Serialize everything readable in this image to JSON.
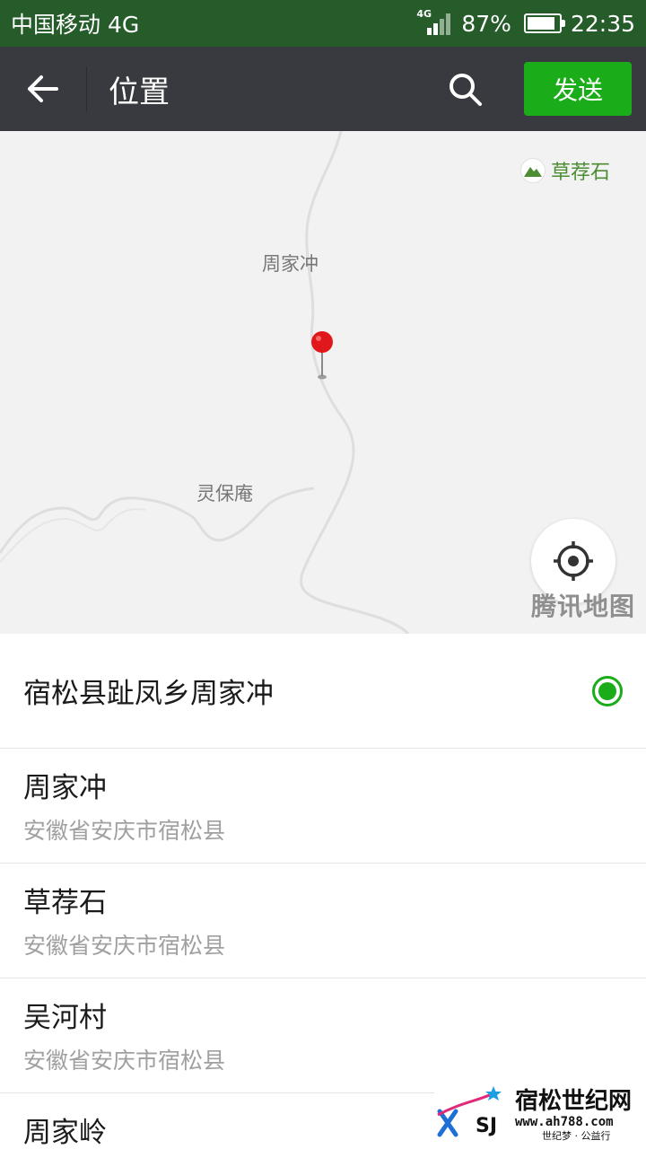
{
  "status_bar": {
    "carrier": "中国移动 4G",
    "network_tag": "4G",
    "battery": "87%",
    "battery_level": 0.87,
    "time": "22:35"
  },
  "header": {
    "title": "位置",
    "send_label": "发送",
    "back_icon": "arrow-left-icon",
    "search_icon": "search-icon"
  },
  "map": {
    "labels": {
      "zhoujiachong": "周家冲",
      "lingbaoan": "灵保庵"
    },
    "poi_label": "草荐石",
    "provider": "腾讯地图",
    "pin_color": "#e0171b",
    "locate_icon": "crosshair-icon"
  },
  "selected": {
    "name": "宿松县趾凤乡周家冲"
  },
  "places": [
    {
      "name": "周家冲",
      "address": "安徽省安庆市宿松县"
    },
    {
      "name": "草荐石",
      "address": "安徽省安庆市宿松县"
    },
    {
      "name": "吴河村",
      "address": "安徽省安庆市宿松县"
    }
  ],
  "last_place": {
    "name": "周家岭"
  },
  "site_watermark": {
    "logo_text": "SJ",
    "title": "宿松世纪网",
    "url": "www.ah788.com",
    "slogan": "世纪梦 · 公益行"
  },
  "colors": {
    "status_bar": "#255c2a",
    "title_bar": "#393a3f",
    "accent": "#1aad19",
    "poi_green": "#4b8d33"
  }
}
